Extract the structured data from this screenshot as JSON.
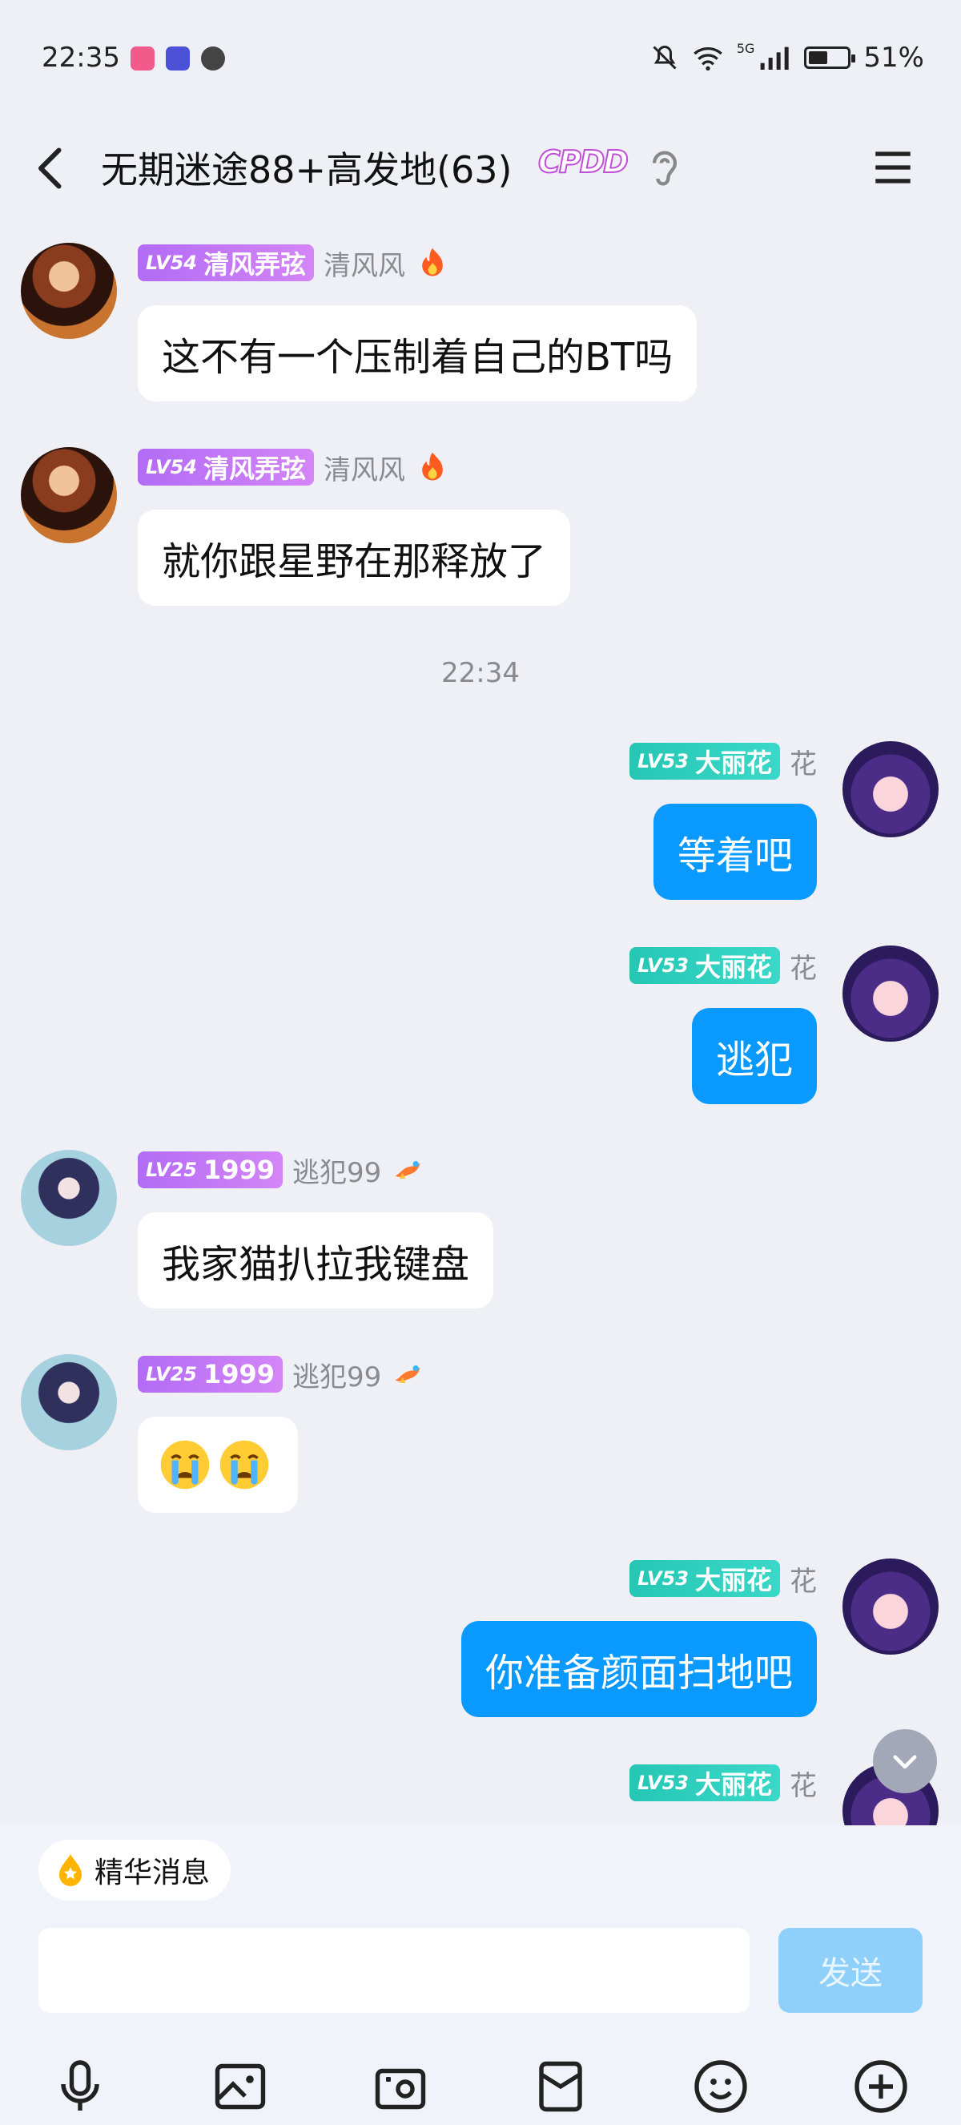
{
  "status_bar": {
    "time": "22:35",
    "network": "5G",
    "battery_level": 0.51,
    "battery_text": "51%"
  },
  "header": {
    "title": "无期迷途88+高发地(63)",
    "badge": "CPDD"
  },
  "messages": [
    {
      "side": "left",
      "level": "LV54",
      "title": "清风弄弦",
      "nickname": "清风风",
      "text": "这不有一个压制着自己的BT吗"
    },
    {
      "side": "left",
      "level": "LV54",
      "title": "清风弄弦",
      "nickname": "清风风",
      "text": "就你跟星野在那释放了"
    },
    {
      "side": "right",
      "level": "LV53",
      "title": "大丽花",
      "nickname": "花",
      "text": "等着吧"
    },
    {
      "side": "right",
      "level": "LV53",
      "title": "大丽花",
      "nickname": "花",
      "text": "逃犯"
    },
    {
      "side": "left",
      "level": "LV25",
      "title": "1999",
      "nickname": "逃犯99",
      "text": "我家猫扒拉我键盘"
    },
    {
      "side": "left",
      "level": "LV25",
      "title": "1999",
      "nickname": "逃犯99",
      "text": ""
    },
    {
      "side": "right",
      "level": "LV53",
      "title": "大丽花",
      "nickname": "花",
      "text": "你准备颜面扫地吧"
    },
    {
      "side": "right",
      "level": "LV53",
      "title": "大丽花",
      "nickname": "花",
      "text": ""
    }
  ],
  "timestamp": "22:34",
  "bottom": {
    "essence_label": "精华消息",
    "input_value": "",
    "input_placeholder": "",
    "send_label": "发送"
  },
  "colors": {
    "background": "#eef0f5",
    "my_bubble": "#0a99ff",
    "send_disabled": "#8fd0fb",
    "lv_purple": "#b26bf5",
    "lv_teal": "#26c6b4"
  },
  "icons": [
    "back-arrow-icon",
    "ear-icon",
    "menu-icon",
    "flame-icon",
    "dragon-icon",
    "crying-face-icon",
    "scroll-down-icon",
    "droplet-icon",
    "microphone-icon",
    "image-icon",
    "camera-icon",
    "red-packet-icon",
    "emoji-icon",
    "plus-icon"
  ]
}
